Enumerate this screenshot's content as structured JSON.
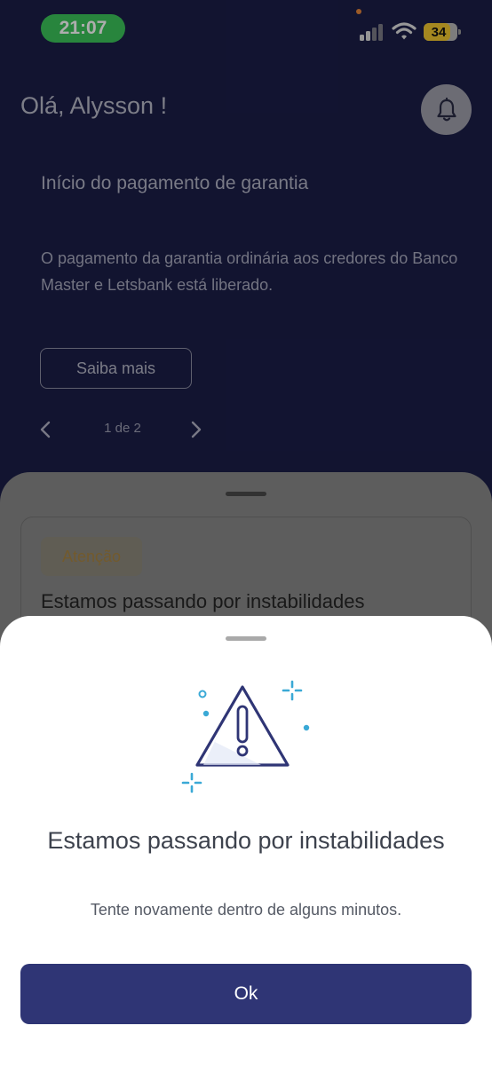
{
  "status_bar": {
    "time": "21:07",
    "battery_level": "34"
  },
  "header": {
    "greeting": "Olá, Alysson !",
    "notification_icon": "bell-icon"
  },
  "banner": {
    "title": "Início do pagamento de garantia",
    "text": "O pagamento da garantia ordinária aos credores do Banco Master e Letsbank está liberado.",
    "button_label": "Saiba mais",
    "pager_label": "1 de 2"
  },
  "alert_card": {
    "badge": "Atenção",
    "title": "Estamos passando por instabilidades"
  },
  "modal": {
    "icon": "warning-triangle-icon",
    "title": "Estamos passando por instabilidades",
    "subtitle": "Tente novamente dentro de alguns minutos.",
    "button_label": "Ok"
  },
  "colors": {
    "background": "#1b1e48",
    "primary_button": "#2f3575",
    "status_time_pill": "#3cc45a",
    "battery": "#f2c830",
    "accent_sparkle": "#3aa9d6"
  }
}
